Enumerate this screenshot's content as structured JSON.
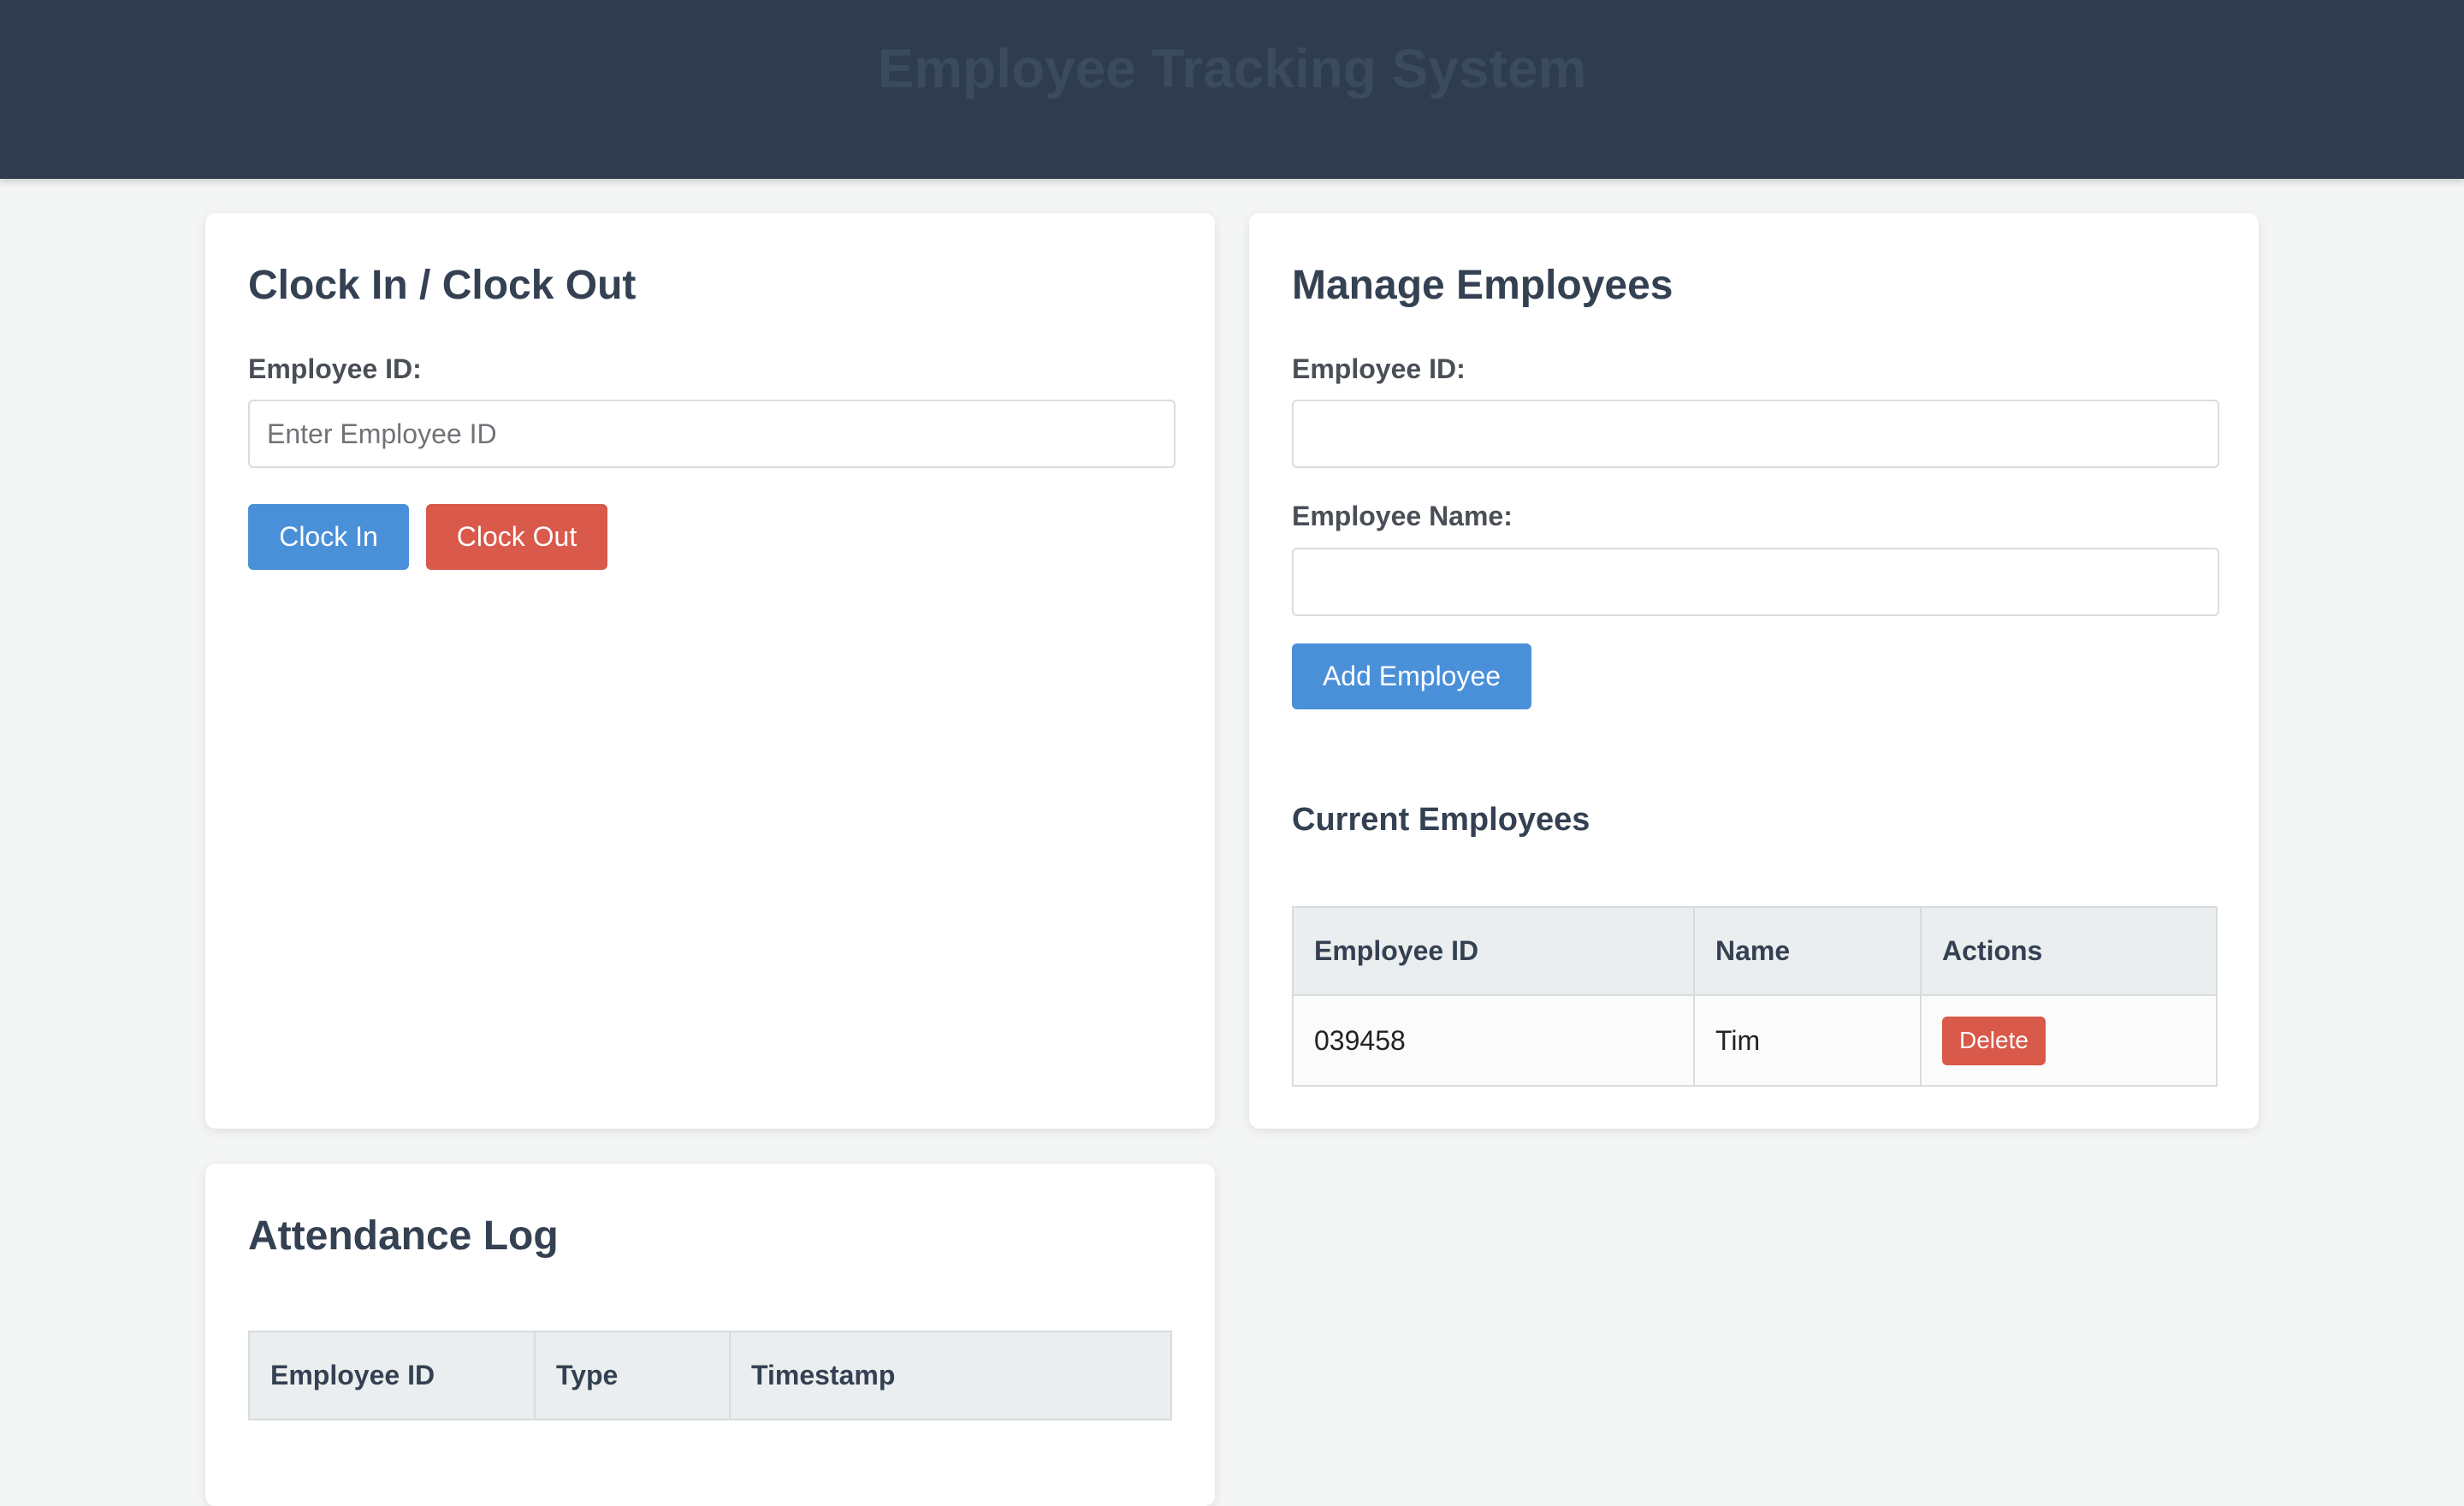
{
  "header": {
    "title": "Employee Tracking System"
  },
  "clock": {
    "title": "Clock In / Clock Out",
    "employee_id_label": "Employee ID:",
    "employee_id_placeholder": "Enter Employee ID",
    "employee_id_value": "",
    "clock_in_label": "Clock In",
    "clock_out_label": "Clock Out"
  },
  "manage": {
    "title": "Manage Employees",
    "employee_id_label": "Employee ID:",
    "employee_id_value": "",
    "employee_name_label": "Employee Name:",
    "employee_name_value": "",
    "add_button_label": "Add Employee",
    "current_title": "Current Employees",
    "table": {
      "headers": [
        "Employee ID",
        "Name",
        "Actions"
      ],
      "rows": [
        {
          "id": "039458",
          "name": "Tim",
          "action": "Delete"
        }
      ]
    }
  },
  "attendance": {
    "title": "Attendance Log",
    "table": {
      "headers": [
        "Employee ID",
        "Type",
        "Timestamp"
      ]
    }
  },
  "colors": {
    "header_bg": "#2f3c4e",
    "primary": "#4a90d9",
    "danger": "#d9594a",
    "page_bg": "#f4f5f5"
  }
}
